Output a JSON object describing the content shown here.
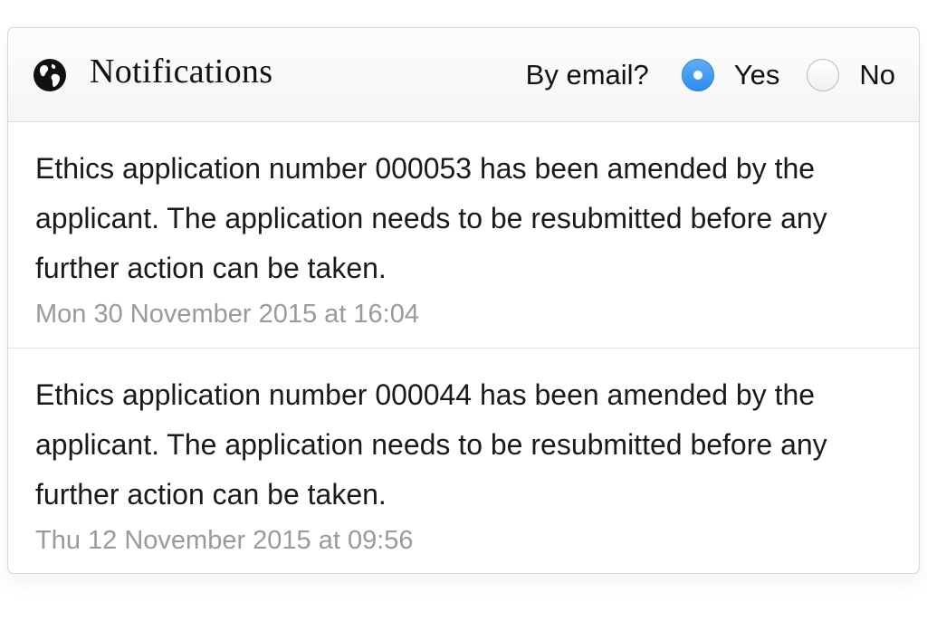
{
  "header": {
    "title": "Notifications",
    "icon": "globe-icon",
    "email_question": "By email?",
    "options": [
      {
        "label": "Yes",
        "selected": true
      },
      {
        "label": "No",
        "selected": false
      }
    ]
  },
  "notifications": [
    {
      "message": "Ethics application number 000053 has been amended by the applicant. The application needs to be resubmitted before any further action can be taken.",
      "timestamp": "Mon 30 November 2015 at 16:04"
    },
    {
      "message": "Ethics application number 000044 has been amended by the applicant. The application needs to be resubmitted before any further action can be taken.",
      "timestamp": "Thu 12 November 2015 at 09:56"
    }
  ],
  "colors": {
    "accent": "#3a93f0",
    "timestamp": "#9a9a9a",
    "text": "#1a1a1a"
  }
}
